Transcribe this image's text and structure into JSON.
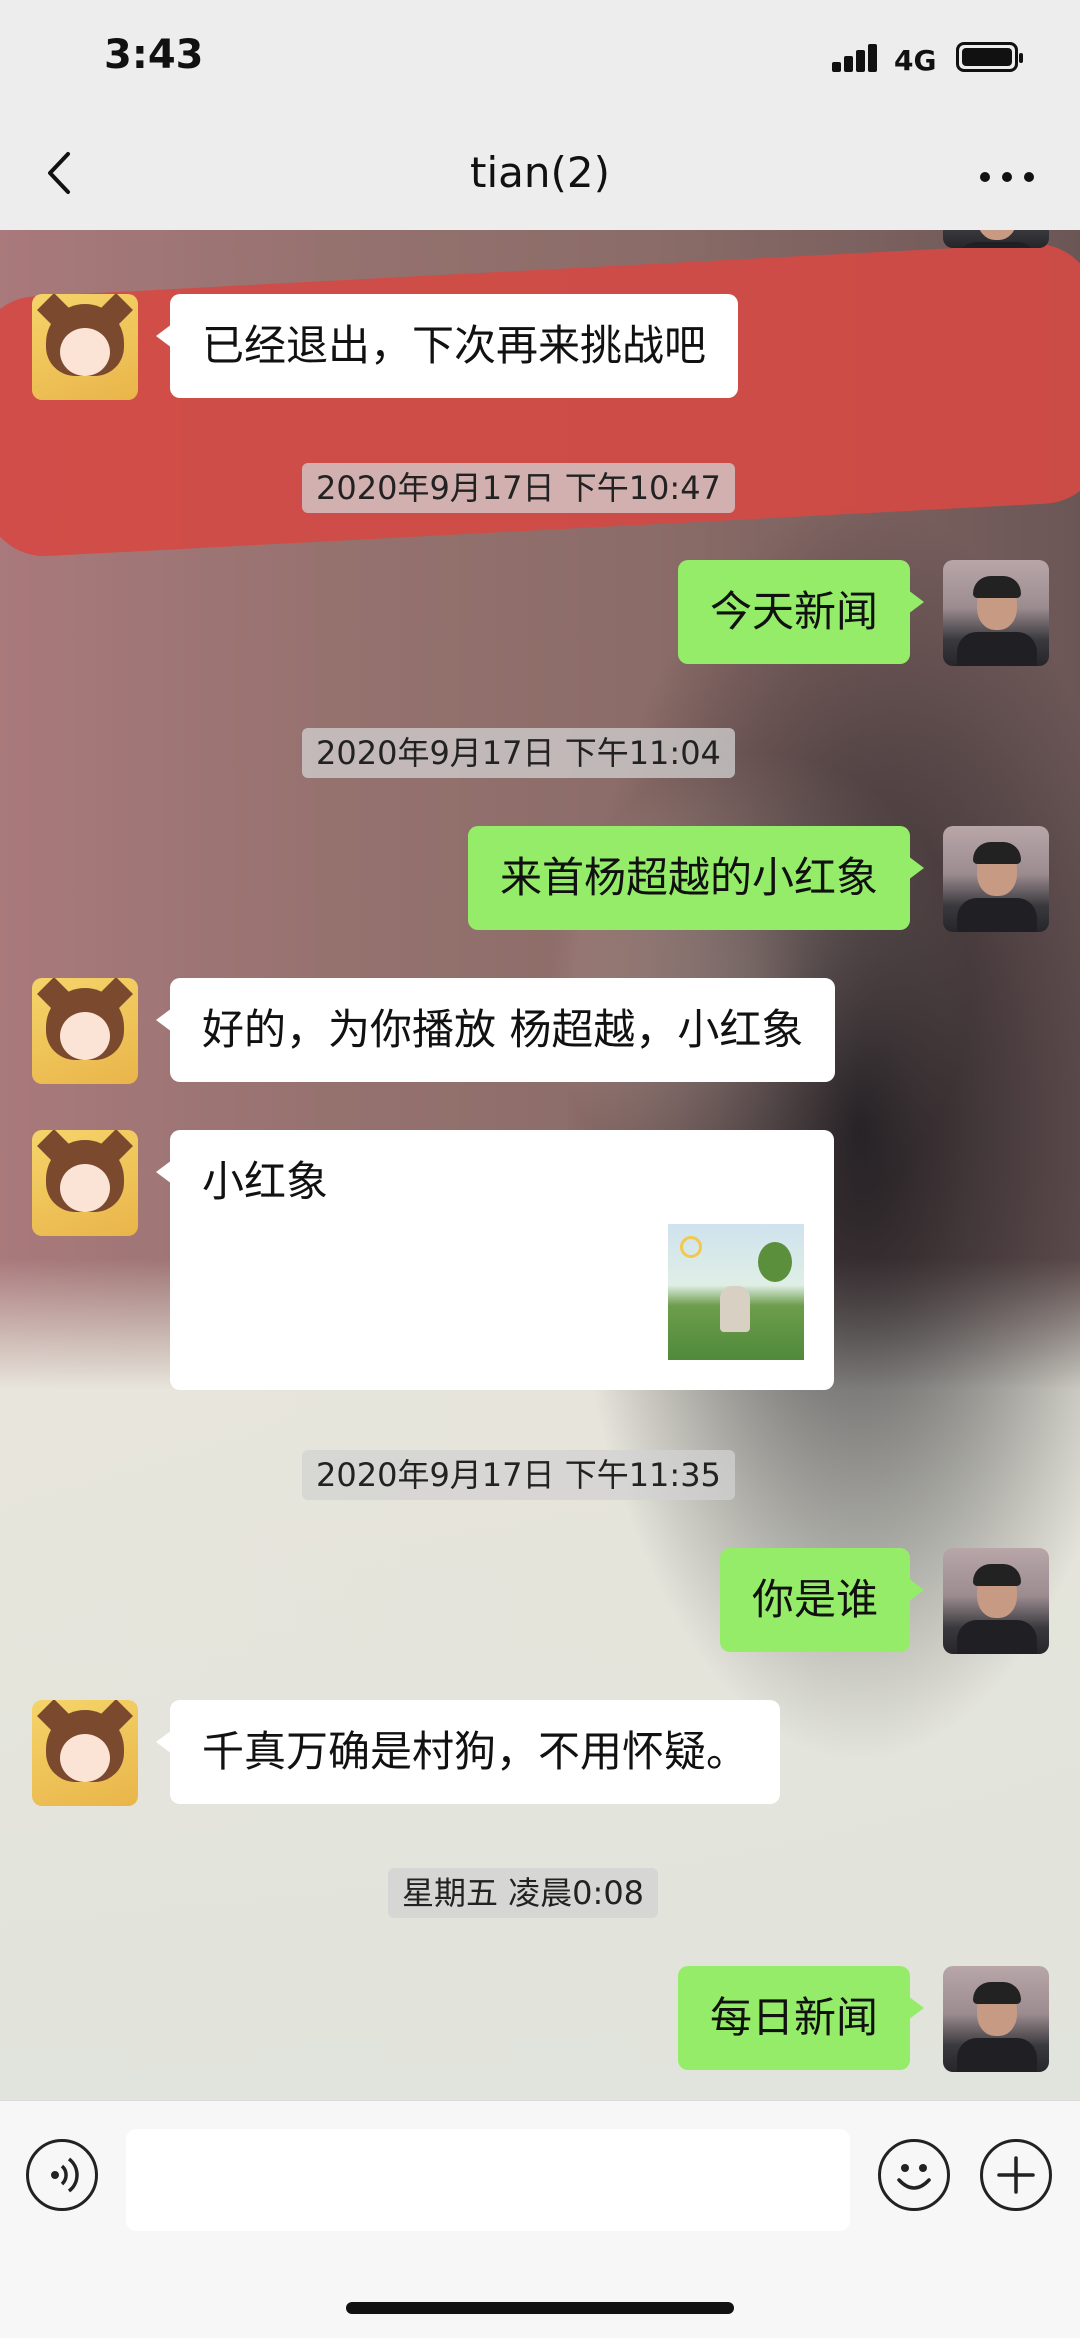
{
  "status_bar": {
    "time": "3:43",
    "network": "4G"
  },
  "nav": {
    "title": "tian(2)"
  },
  "messages": [
    {
      "type": "text",
      "side": "left",
      "text": "已经退出，下次再来挑战吧"
    },
    {
      "type": "time",
      "text": "2020年9月17日 下午10:47"
    },
    {
      "type": "text",
      "side": "right",
      "text": "今天新闻"
    },
    {
      "type": "time",
      "text": "2020年9月17日 下午11:04"
    },
    {
      "type": "text",
      "side": "right",
      "text": "来首杨超越的小红象"
    },
    {
      "type": "text",
      "side": "left",
      "text": "好的，为你播放 杨超越，小红象"
    },
    {
      "type": "card",
      "side": "left",
      "text": "小红象"
    },
    {
      "type": "time",
      "text": "2020年9月17日 下午11:35"
    },
    {
      "type": "text",
      "side": "right",
      "text": "你是谁"
    },
    {
      "type": "text",
      "side": "left",
      "text": "千真万确是村狗，不用怀疑。"
    },
    {
      "type": "time",
      "text": "星期五 凌晨0:08"
    },
    {
      "type": "text",
      "side": "right",
      "text": "每日新闻"
    }
  ],
  "input": {
    "placeholder": ""
  },
  "icons": {
    "back": "chevron-left-icon",
    "more": "ellipsis-icon",
    "voice": "voice-icon",
    "emoji": "emoji-icon",
    "plus": "plus-icon"
  },
  "colors": {
    "bubble_self": "#95ec69",
    "bubble_other": "#ffffff",
    "bar_bg": "#ededed"
  }
}
